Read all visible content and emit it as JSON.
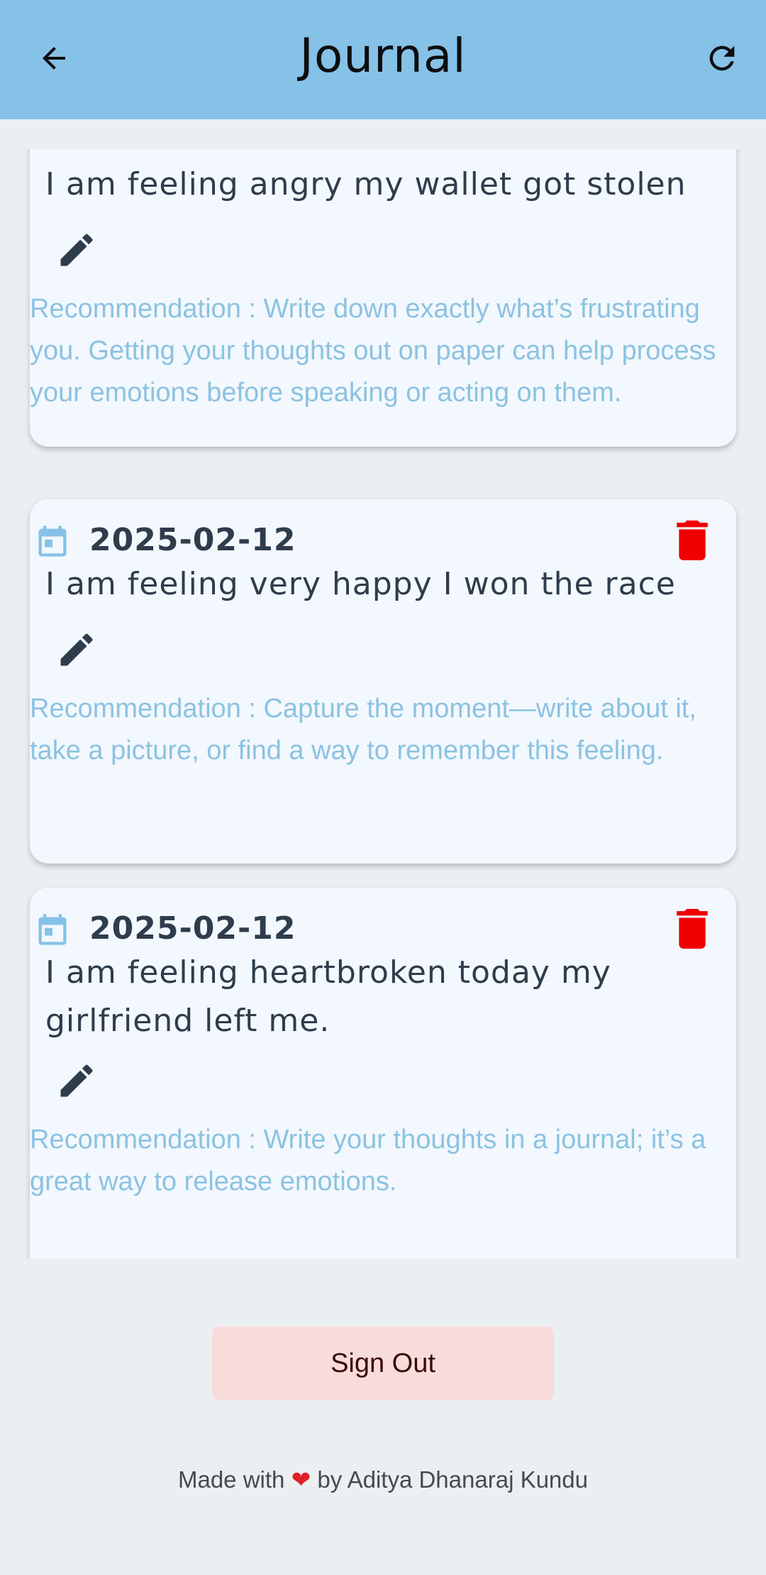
{
  "appbar": {
    "title": "Journal",
    "back_icon": "arrow-left-icon",
    "refresh_icon": "refresh-icon",
    "background": "#86C1E8"
  },
  "entries": [
    {
      "date": "",
      "text": "I am feeling angry my wallet got stolen",
      "recommendation": "Recommendation : Write down exactly what’s frustrating you. Getting your thoughts out on paper can help process your emotions before speaking or acting on them."
    },
    {
      "date": "2025-02-12",
      "text": "I am feeling very happy I won the race",
      "recommendation": "Recommendation : Capture the moment—write about it, take a picture, or find a way to remember this feeling."
    },
    {
      "date": "2025-02-12",
      "text": "I am feeling heartbroken today my girlfriend left me.",
      "recommendation": "Recommendation : Write your thoughts in a journal; it’s a great way to release emotions."
    }
  ],
  "icons": {
    "calendar": "calendar-icon",
    "delete": "trash-icon",
    "edit": "pencil-icon"
  },
  "colors": {
    "text_dark": "#2F3C4C",
    "recommendation": "#8CC2E2",
    "delete_red": "#F00000",
    "signout_bg": "#F8DCDA"
  },
  "signout_label": "Sign Out",
  "footer": {
    "prefix": "Made with",
    "heart": "❤",
    "suffix": "by Aditya Dhanaraj Kundu"
  }
}
